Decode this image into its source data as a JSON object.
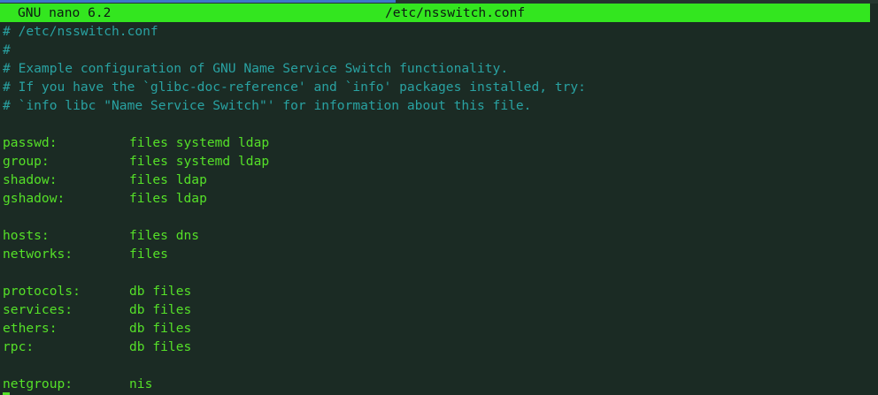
{
  "titlebar": {
    "app_version": "GNU nano 6.2",
    "filename": "/etc/nsswitch.conf"
  },
  "lines": [
    {
      "type": "comment",
      "text": "# /etc/nsswitch.conf"
    },
    {
      "type": "comment",
      "text": "#"
    },
    {
      "type": "comment",
      "text": "# Example configuration of GNU Name Service Switch functionality."
    },
    {
      "type": "comment",
      "text": "# If you have the `glibc-doc-reference' and `info' packages installed, try:"
    },
    {
      "type": "comment",
      "text": "# `info libc \"Name Service Switch\"' for information about this file."
    },
    {
      "type": "blank"
    },
    {
      "type": "entry",
      "key": "passwd:",
      "value": "files systemd ldap"
    },
    {
      "type": "entry",
      "key": "group:",
      "value": "files systemd ldap"
    },
    {
      "type": "entry",
      "key": "shadow:",
      "value": "files ldap"
    },
    {
      "type": "entry",
      "key": "gshadow:",
      "value": "files ldap"
    },
    {
      "type": "blank"
    },
    {
      "type": "entry",
      "key": "hosts:",
      "value": "files dns"
    },
    {
      "type": "entry",
      "key": "networks:",
      "value": "files"
    },
    {
      "type": "blank"
    },
    {
      "type": "entry",
      "key": "protocols:",
      "value": "db files"
    },
    {
      "type": "entry",
      "key": "services:",
      "value": "db files"
    },
    {
      "type": "entry",
      "key": "ethers:",
      "value": "db files"
    },
    {
      "type": "entry",
      "key": "rpc:",
      "value": "db files"
    },
    {
      "type": "blank"
    },
    {
      "type": "entry",
      "key": "netgroup:",
      "value": "nis"
    }
  ],
  "colors": {
    "background": "#1b2b24",
    "titlebar": "#33e61f",
    "comment": "#29a2a2",
    "text": "#55e028"
  }
}
